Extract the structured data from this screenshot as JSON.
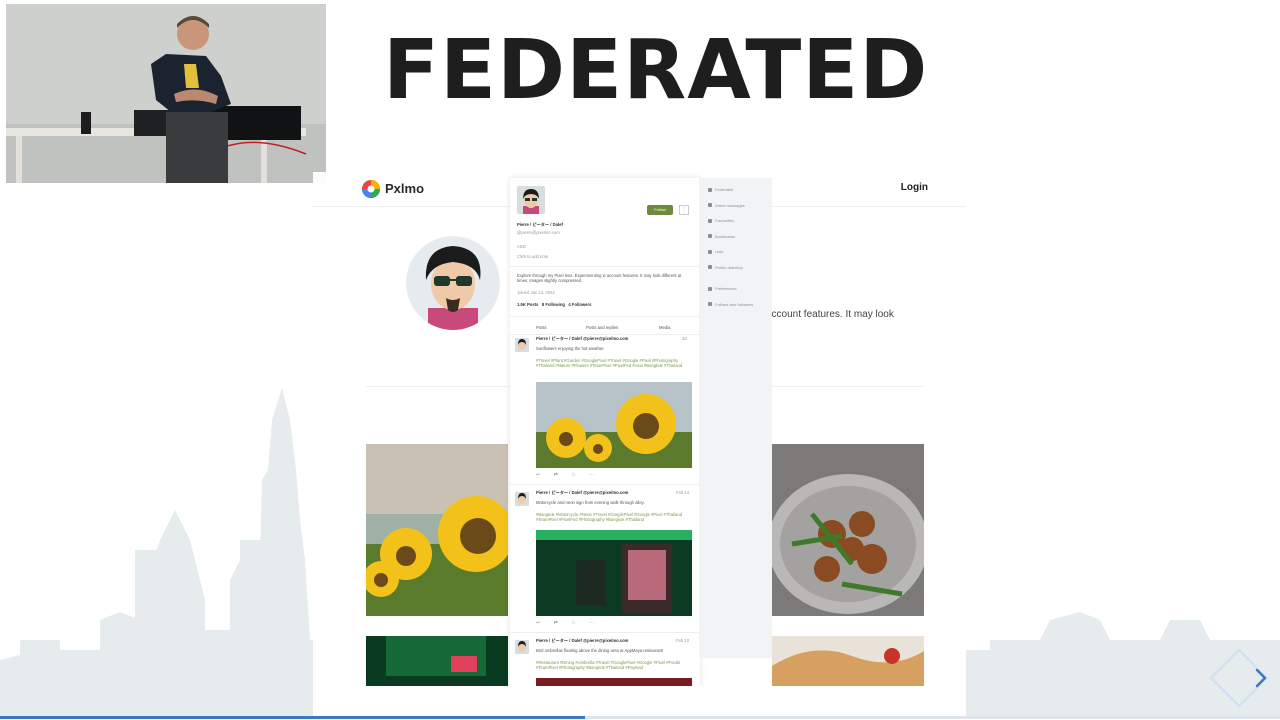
{
  "slide": {
    "title": "FEDERATED",
    "progress_fraction": 0.457
  },
  "pixelfed": {
    "app_name": "Pxlmo",
    "login_label": "Login",
    "bio_fragment": "account features. It may look"
  },
  "mobile": {
    "display_name": "Pierre / ピーター / Dalef",
    "handle": "@pierre@pixelmo.com",
    "follow_label": "Follow",
    "more_label": "⋮",
    "small_line_1": "ADD",
    "small_line_2": "Click to add note",
    "bio": "Explore through my Pixel lens. Experimenting w account features. It may look different at times. Images slightly compressed.",
    "joined": "Joined Jan 13, 2024",
    "stats": "1.5K Posts   8 Following   4 Followers",
    "tabs": [
      "Posts",
      "Posts and replies",
      "Media"
    ],
    "sidebar_items": [
      "Federated",
      "Direct messages",
      "Favourites",
      "Bookmarks",
      "Lists",
      "Profile directory",
      "Preferences",
      "Follows and followers"
    ],
    "posts": [
      {
        "author": "Pierre / ピーター / Dalef @pierre@pixelmo.com",
        "time": "3d",
        "text": "Sunflowers enjoying the hot weather.",
        "tags": "#Travel #Plant #Garden #GooglePixel #Travel #Google #Pixel #Photography #Thailand #Nature #Flowers #TeamPixel #PixelFed #Asia #Bangkok #Thailand"
      },
      {
        "author": "Pierre / ピーター / Dalef @pierre@pixelmo.com",
        "time": "Feb 14",
        "text": "Motorcycle and neon sign from evening walk through alley.",
        "tags": "#Bangkok #Motorcycle #Neon #Travel #GooglePixel #Google #Pixel #Thailand #TeamPixel #PixelFed #Photography #Bangkok #Thailand"
      },
      {
        "author": "Pierre / ピーター / Dalef @pierre@pixelmo.com",
        "time": "Feb 10",
        "text": "Bird umbrellas floating above the dining area at AppMaya restaurant!",
        "tags": "#Restaurant #Dining #Umbrella #Travel #GooglePixel #Google #Pixel #Foods #TeamPixel #Photography #Bangkok #Thailand #Payload"
      }
    ],
    "post_actions": [
      "reply-icon",
      "boost-icon",
      "favourite-icon",
      "more-icon"
    ]
  },
  "icons": {
    "logo": "pixelfed-logo-icon",
    "next": "next-slide-chevron-icon"
  },
  "colors": {
    "title": "#1e1e1e",
    "skyline": "#e6ebee",
    "progress": "#3f78c2",
    "follow_button": "#6e8b3d",
    "hashtag": "#7b9a48"
  }
}
